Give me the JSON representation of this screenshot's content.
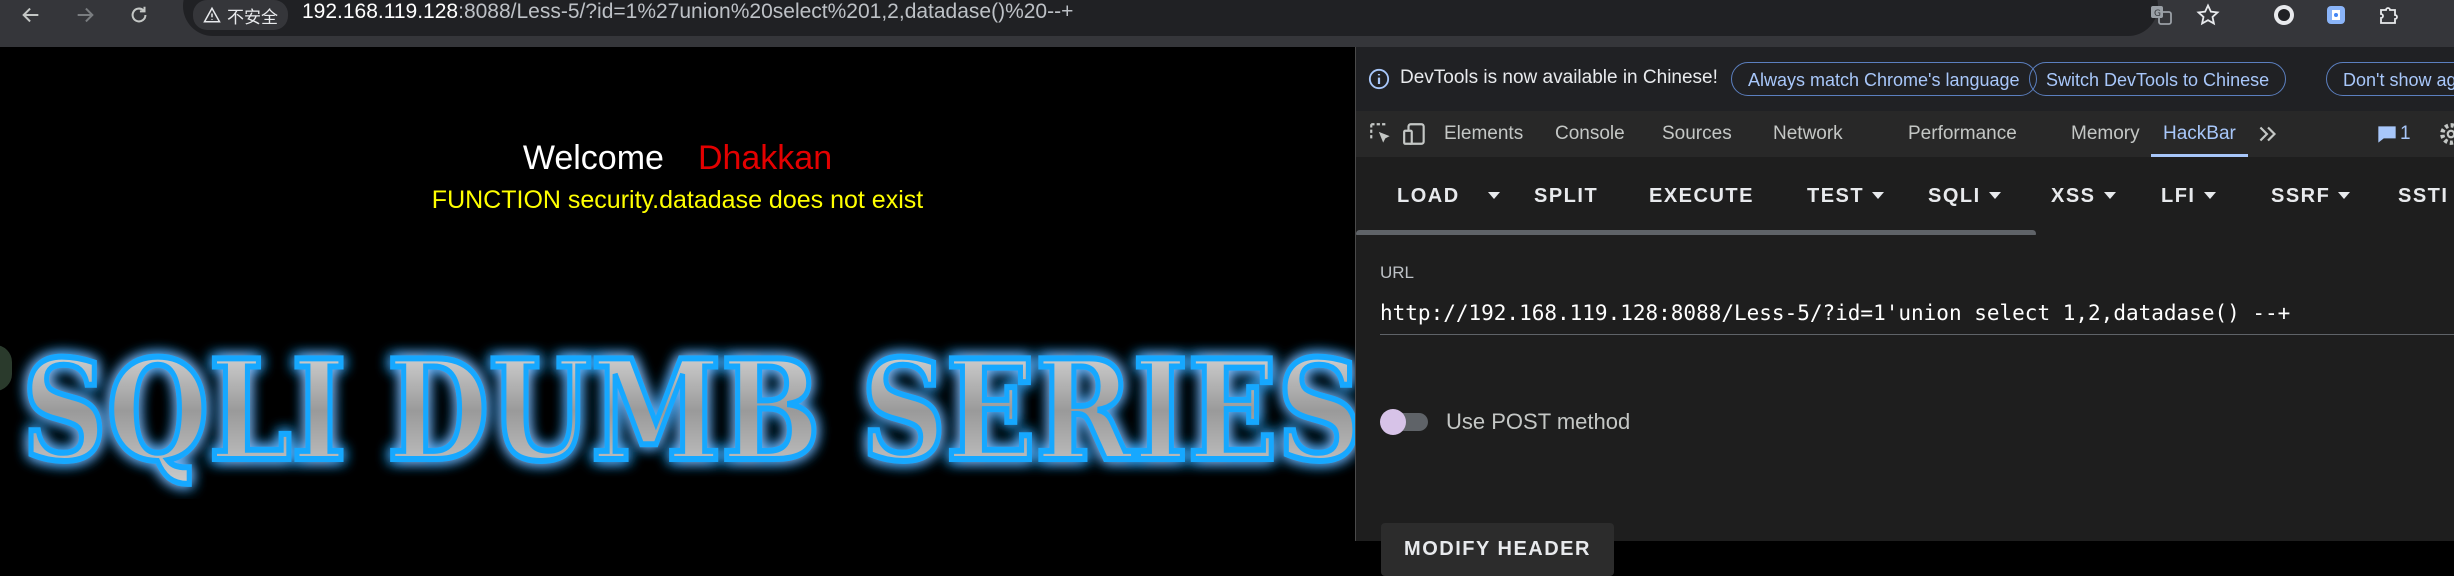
{
  "browser": {
    "security_label": "不安全",
    "url_host": "192.168.119.128",
    "url_rest": ":8088/Less-5/?id=1%27union%20select%201,2,datadase()%20--+",
    "icons": [
      "back-arrow-icon",
      "forward-arrow-icon",
      "reload-icon",
      "warning-icon",
      "translate-icon",
      "star-icon",
      "extension-icon",
      "profile-icon",
      "puzzle-icon"
    ]
  },
  "page": {
    "welcome": "Welcome",
    "name": "Dhakkan",
    "error": "FUNCTION security.datadase does not exist",
    "logo_text": "SQLI DUMB SERIES",
    "colors": {
      "welcome": "#ffffff",
      "name": "#e30000",
      "error": "#ffff00",
      "logo_glow": "#18a8ff"
    }
  },
  "devtools": {
    "info_text": "DevTools is now available in Chinese!",
    "buttons": [
      "Always match Chrome's language",
      "Switch DevTools to Chinese",
      "Don't show ag"
    ],
    "tabs": [
      "Elements",
      "Console",
      "Sources",
      "Network",
      "Performance",
      "Memory",
      "HackBar"
    ],
    "active_tab": "HackBar",
    "badge_count": "1"
  },
  "hackbar": {
    "load": "LOAD",
    "split": "SPLIT",
    "execute": "EXECUTE",
    "test": "TEST",
    "sqli": "SQLI",
    "xss": "XSS",
    "lfi": "LFI",
    "ssrf": "SSRF",
    "ssti": "SSTI",
    "url_label": "URL",
    "url_pre": "http://192.168.119.128:8088/Less-5/?id=1'union select 1,2,",
    "url_func": "datadase",
    "url_post": "() --+",
    "post_label": "Use POST method",
    "modify_header": "MODIFY HEADER"
  }
}
